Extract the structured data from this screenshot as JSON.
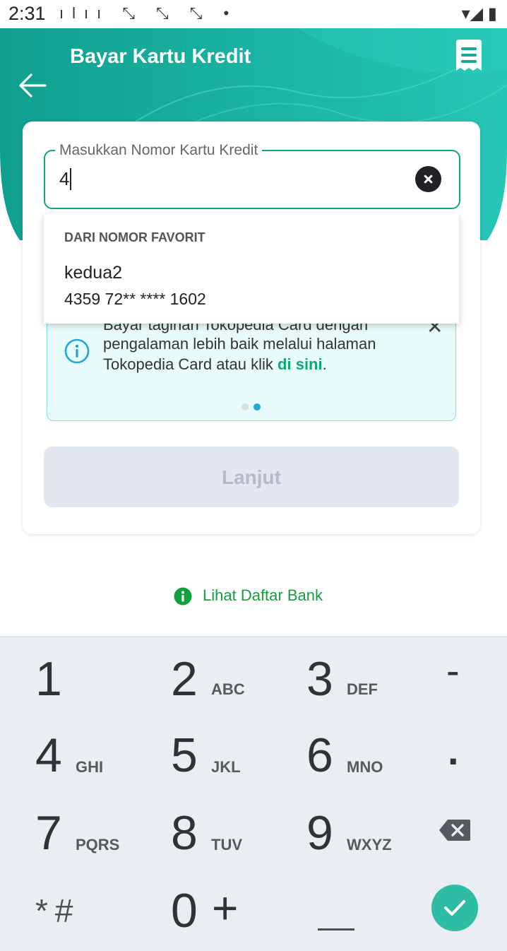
{
  "status_bar": {
    "time": "2:31",
    "notification_icons": "ılıı ⤡ ⤡ ⤡ •",
    "system_icons": "▾◢ ▮"
  },
  "colors": {
    "header_green": "#12a79a",
    "accent_green": "#10a871",
    "info_blue": "#1ea7d8",
    "done_teal": "#2fbca4"
  },
  "header": {
    "title": "Bayar Kartu Kredit",
    "back_icon": "arrow-left-icon",
    "receipt_icon": "receipt-icon"
  },
  "form": {
    "label": "Masukkan Nomor Kartu Kredit",
    "value": "4"
  },
  "dropdown": {
    "header": "DARI NOMOR FAVORIT",
    "items": [
      {
        "name": "kedua2",
        "number": "4359 72** **** 1602"
      }
    ]
  },
  "info_banner": {
    "clipped_text": "Bayar tagihan Tokopedia Card dengan",
    "text": "pengalaman lebih baik melalui halaman Tokopedia Card atau klik",
    "link": "di sini",
    "suffix": ".",
    "close_glyph": "✕",
    "pages": 2,
    "active_page": 2
  },
  "next_button": {
    "label": "Lanjut"
  },
  "bank_link": {
    "label": "Lihat Daftar Bank"
  },
  "keyboard": {
    "keys": [
      {
        "num": "1",
        "letters": ""
      },
      {
        "num": "2",
        "letters": "ABC"
      },
      {
        "num": "3",
        "letters": "DEF"
      },
      {
        "num": "-",
        "letters": ""
      },
      {
        "num": "4",
        "letters": "GHI"
      },
      {
        "num": "5",
        "letters": "JKL"
      },
      {
        "num": "6",
        "letters": "MNO"
      },
      {
        "num": ".",
        "letters": ""
      },
      {
        "num": "7",
        "letters": "PQRS"
      },
      {
        "num": "8",
        "letters": "TUV"
      },
      {
        "num": "9",
        "letters": "WXYZ"
      },
      {
        "num": "*#",
        "letters": ""
      },
      {
        "num": "0",
        "letters": ""
      },
      {
        "num": "+",
        "letters": ""
      }
    ]
  }
}
